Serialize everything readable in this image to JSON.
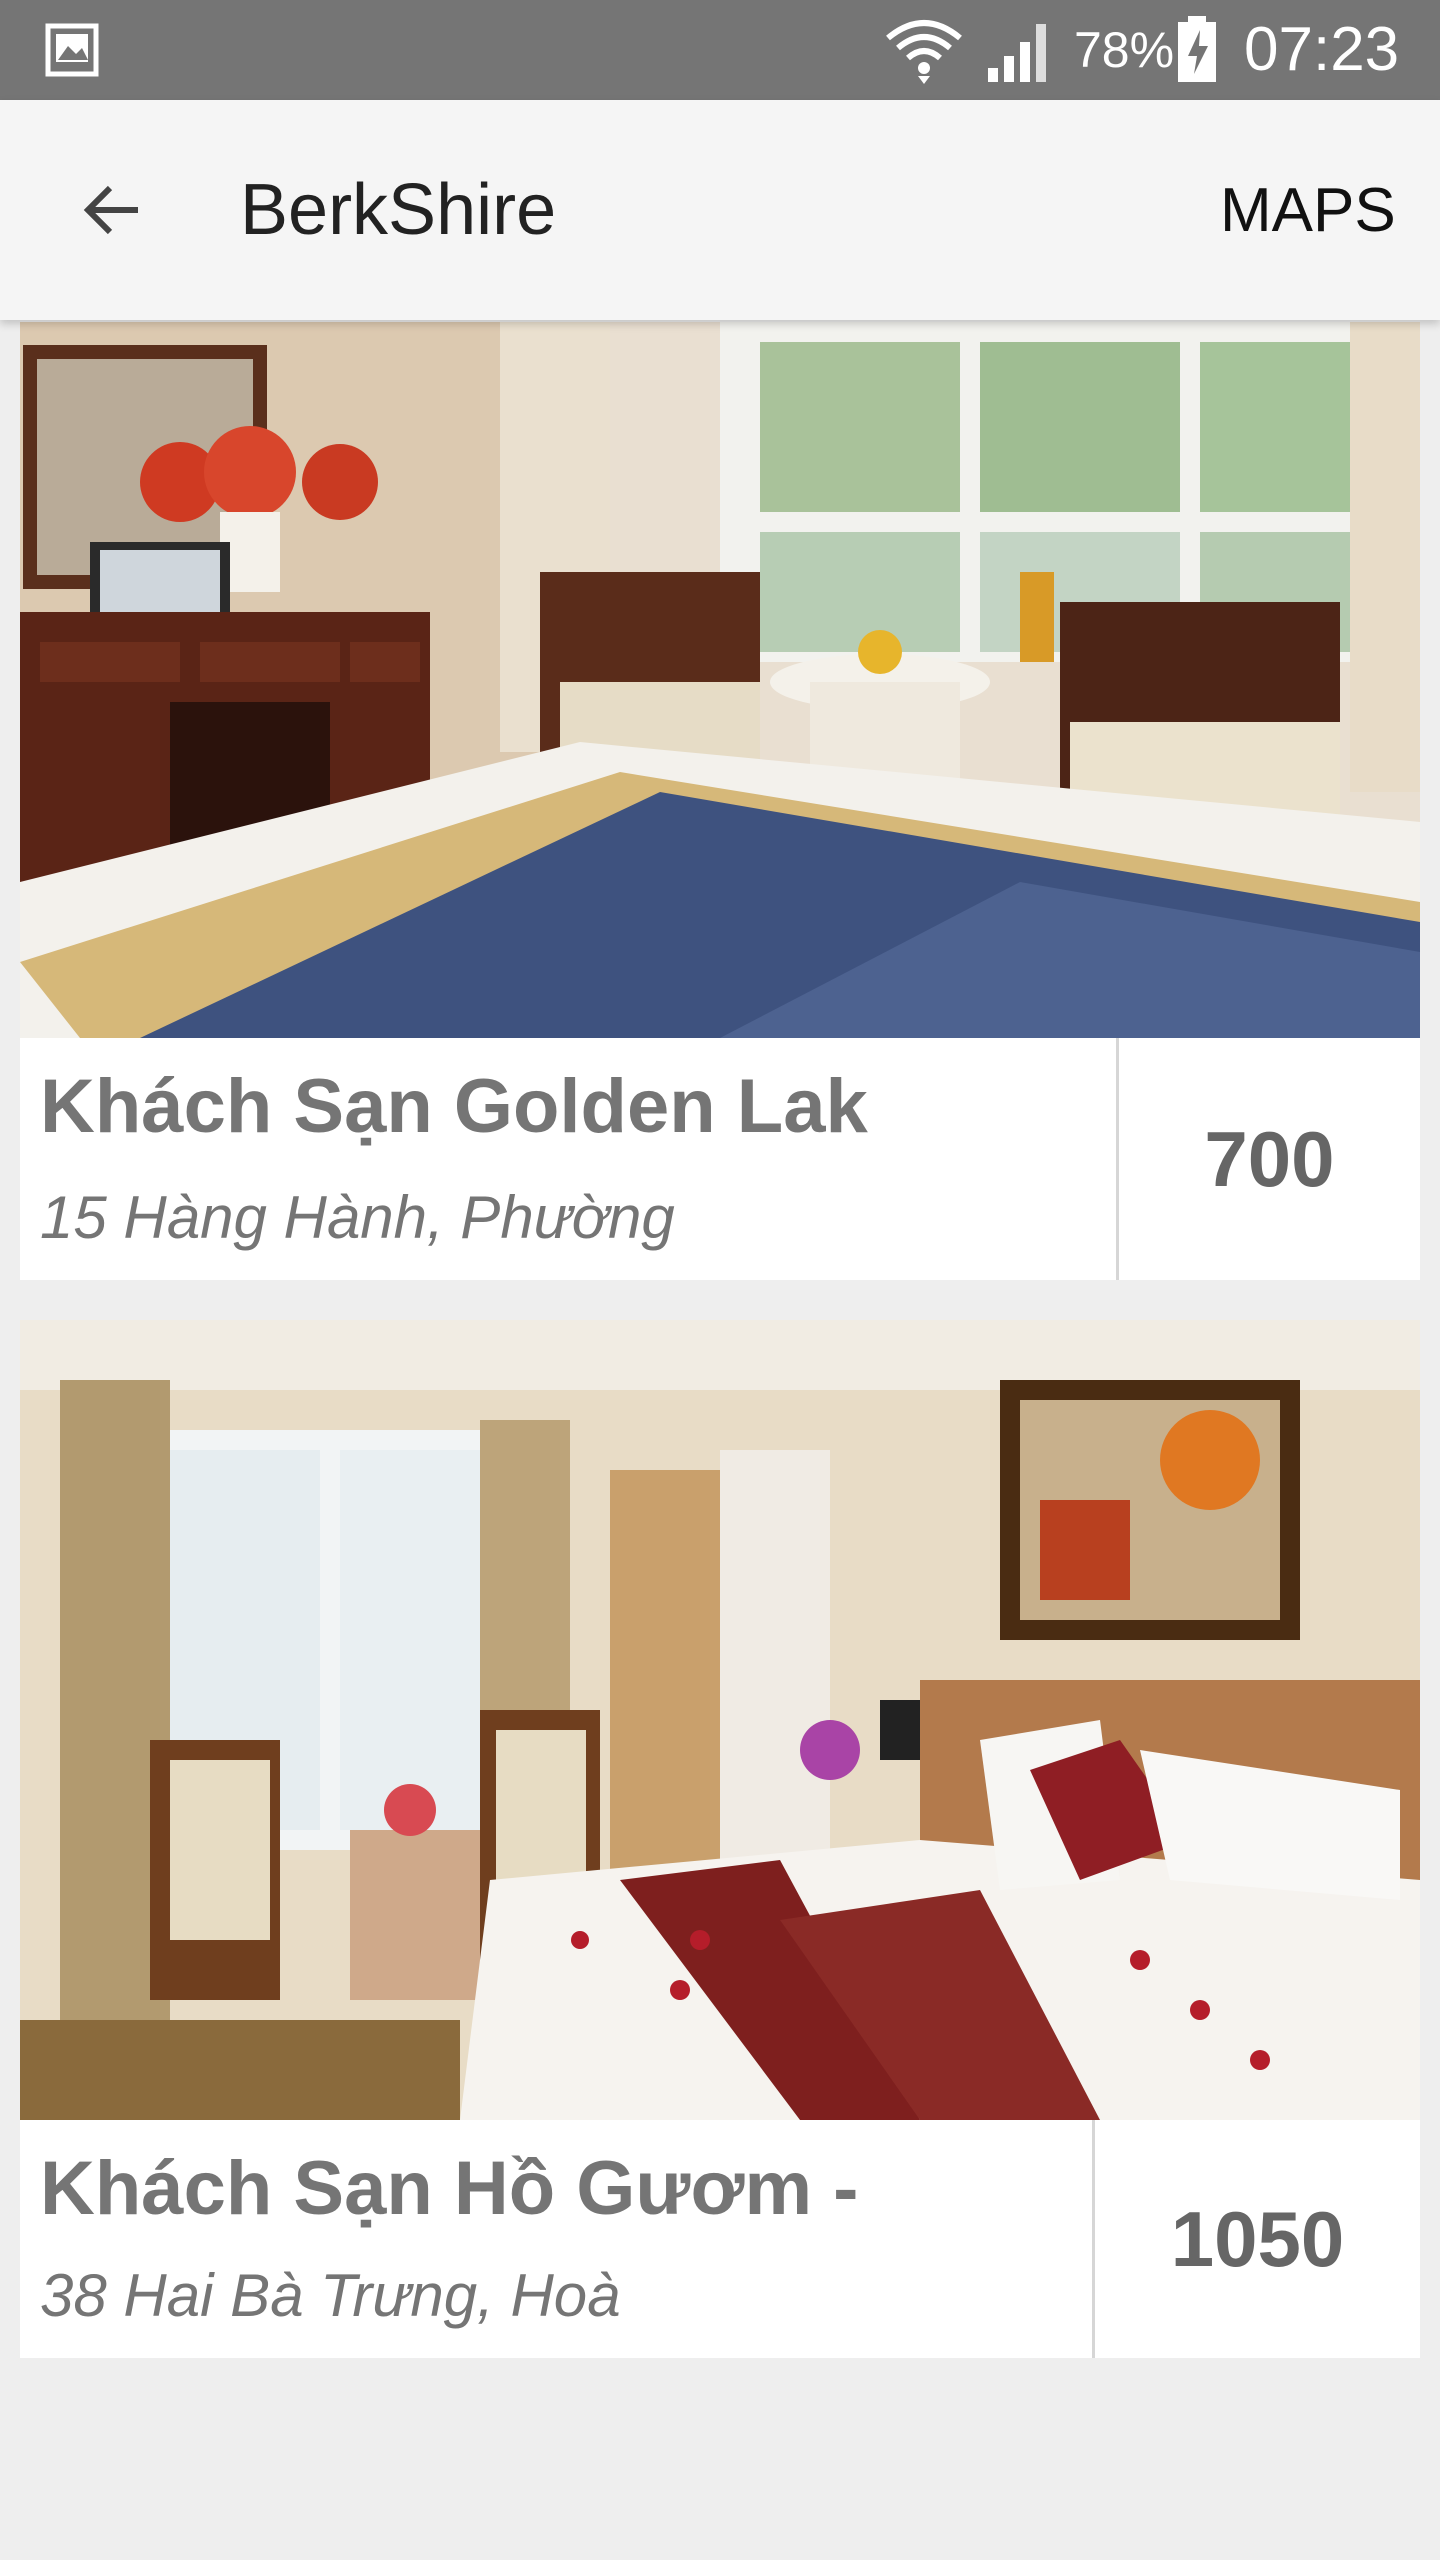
{
  "status_bar": {
    "battery_percent": "78%",
    "time": "07:23",
    "icons": [
      "gallery-icon",
      "wifi-icon",
      "signal-icon",
      "battery-charging-icon"
    ]
  },
  "app_bar": {
    "title": "BerkShire",
    "action": "MAPS",
    "back_icon": "arrow-left-icon"
  },
  "hotels": [
    {
      "name": "Khách Sạn Golden Lak",
      "address": "15 Hàng Hành, Phường",
      "price": "700",
      "image": "hotel-room-photo"
    },
    {
      "name": "Khách Sạn Hồ Gươm -",
      "address": "38 Hai Bà Trưng, Hoà",
      "price": "1050",
      "image": "hotel-room-photo"
    }
  ],
  "colors": {
    "status_bar_bg": "#757575",
    "app_bar_bg": "#f5f5f5",
    "page_bg": "#eeeeee",
    "card_text": "#757575"
  }
}
